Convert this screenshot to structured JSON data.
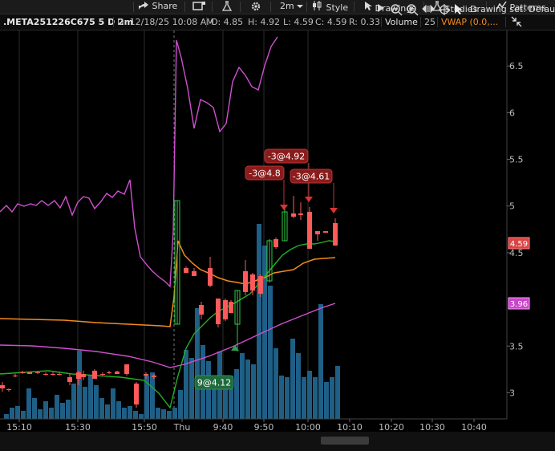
{
  "toolbar": {
    "share": "Share",
    "timeframe": "2m",
    "style": "Style",
    "drawings": "Drawings",
    "studies": "Studies",
    "patterns": "Patterns"
  },
  "infobar": {
    "symbol": ".META251226C675 5 D 2m",
    "date": "D: 12/18/25 10:08 AM",
    "open": "O: 4.85",
    "high": "H: 4.92",
    "low": "L: 4.59",
    "close": "C: 4.59",
    "range": "R: 0.33",
    "volume_label": "Volume",
    "volume_value": "25",
    "vwap": "VWAP (0.0,..."
  },
  "chart_data": {
    "type": "candlestick",
    "y_ticks": [
      "6.5",
      "6",
      "5.5",
      "5",
      "4.5",
      "3.5",
      "3"
    ],
    "x_ticks": [
      "15:10",
      "15:30",
      "15:50",
      "Thu",
      "9:40",
      "9:50",
      "10:00",
      "10:10",
      "10:20",
      "10:30",
      "10:40"
    ],
    "ylim": [
      2.72,
      6.88
    ],
    "price_badges": [
      {
        "text": "4.59",
        "value": 4.59,
        "bg": "#d94545",
        "fg": "#ffffff",
        "border": "#ff8080"
      },
      {
        "text": "3.96",
        "value": 3.96,
        "bg": "#c846c8",
        "fg": "#ffffff",
        "border": "#ff9cff"
      }
    ],
    "trade_labels": [
      {
        "text": "-3@4.92",
        "side": "sell",
        "price": 4.92
      },
      {
        "text": "-3@4.8",
        "side": "sell",
        "price": 4.8
      },
      {
        "text": "-3@4.61",
        "side": "sell",
        "price": 4.61
      },
      {
        "text": "9@4.12",
        "side": "buy",
        "price": 4.12
      }
    ],
    "colors": {
      "up": "#2ecc40",
      "down": "#ff5a5a",
      "volume": "#1f5f86",
      "vwap": "#f58a1f",
      "ma_green": "#22b022",
      "ma_magenta": "#d050d0",
      "underlying": "#d050d0"
    }
  },
  "bottombar": {
    "drawing_set": "Drawing set: Default"
  }
}
